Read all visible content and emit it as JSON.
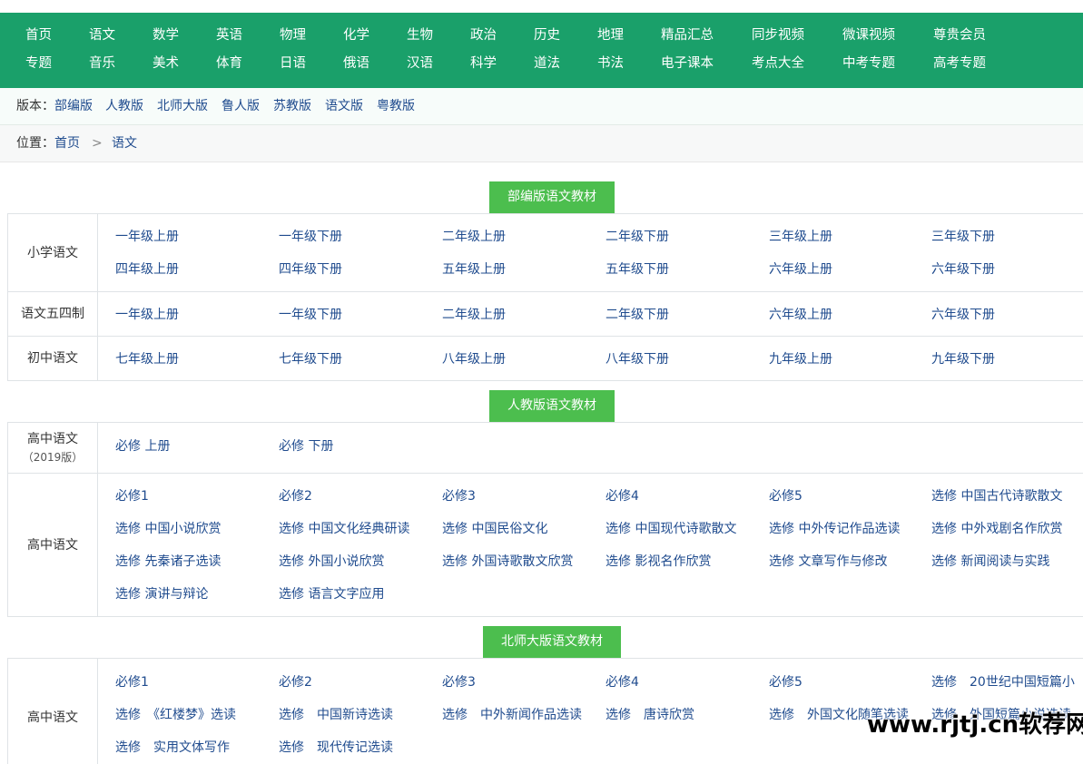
{
  "nav": {
    "row1": [
      "首页",
      "语文",
      "数学",
      "英语",
      "物理",
      "化学",
      "生物",
      "政治",
      "历史",
      "地理",
      "精品汇总",
      "同步视频",
      "微课视频",
      "尊贵会员"
    ],
    "row2": [
      "专题",
      "音乐",
      "美术",
      "体育",
      "日语",
      "俄语",
      "汉语",
      "科学",
      "道法",
      "书法",
      "电子课本",
      "考点大全",
      "中考专题",
      "高考专题"
    ]
  },
  "version": {
    "label": "版本：",
    "links": [
      "部编版",
      "人教版",
      "北师大版",
      "鲁人版",
      "苏教版",
      "语文版",
      "粤教版"
    ]
  },
  "breadcrumb": {
    "label": "位置：",
    "home": "首页",
    "sep": ">",
    "current": "语文"
  },
  "sections": [
    {
      "title": "部编版语文教材",
      "rows": [
        {
          "label": "小学语文",
          "items": [
            "一年级上册",
            "一年级下册",
            "二年级上册",
            "二年级下册",
            "三年级上册",
            "三年级下册",
            "四年级上册",
            "四年级下册",
            "五年级上册",
            "五年级下册",
            "六年级上册",
            "六年级下册"
          ]
        },
        {
          "label": "语文五四制",
          "items": [
            "一年级上册",
            "一年级下册",
            "二年级上册",
            "二年级下册",
            "六年级上册",
            "六年级下册"
          ]
        },
        {
          "label": "初中语文",
          "items": [
            "七年级上册",
            "七年级下册",
            "八年级上册",
            "八年级下册",
            "九年级上册",
            "九年级下册"
          ]
        }
      ]
    },
    {
      "title": "人教版语文教材",
      "rows": [
        {
          "label": "高中语文",
          "sublabel": "（2019版）",
          "items": [
            "必修 上册",
            "必修 下册"
          ]
        },
        {
          "label": "高中语文",
          "items": [
            "必修1",
            "必修2",
            "必修3",
            "必修4",
            "必修5",
            "选修 中国古代诗歌散文",
            "选修 中国小说欣赏",
            "选修 中国文化经典研读",
            "选修 中国民俗文化",
            "选修 中国现代诗歌散文",
            "选修 中外传记作品选读",
            "选修 中外戏剧名作欣赏",
            "选修 先秦诸子选读",
            "选修 外国小说欣赏",
            "选修 外国诗歌散文欣赏",
            "选修 影视名作欣赏",
            "选修 文章写作与修改",
            "选修 新闻阅读与实践",
            "选修 演讲与辩论",
            "选修 语言文字应用"
          ]
        }
      ]
    },
    {
      "title": "北师大版语文教材",
      "rows": [
        {
          "label": "高中语文",
          "items": [
            "必修1",
            "必修2",
            "必修3",
            "必修4",
            "必修5",
            "选修　20世纪中国短篇小",
            "选修　《红楼梦》选读",
            "选修　中国新诗选读",
            "选修　中外新闻作品选读",
            "选修　唐诗欣赏",
            "选修　外国文化随笔选读",
            "选修　外国短篇小说选读",
            "选修　实用文体写作",
            "选修　现代传记选读"
          ]
        }
      ]
    }
  ],
  "watermark": "www.rjtj.cn软荐网",
  "colors": {
    "nav_bg": "#1aa06a",
    "section_title_bg": "#4cbe4e",
    "link": "#1f4b8e"
  }
}
